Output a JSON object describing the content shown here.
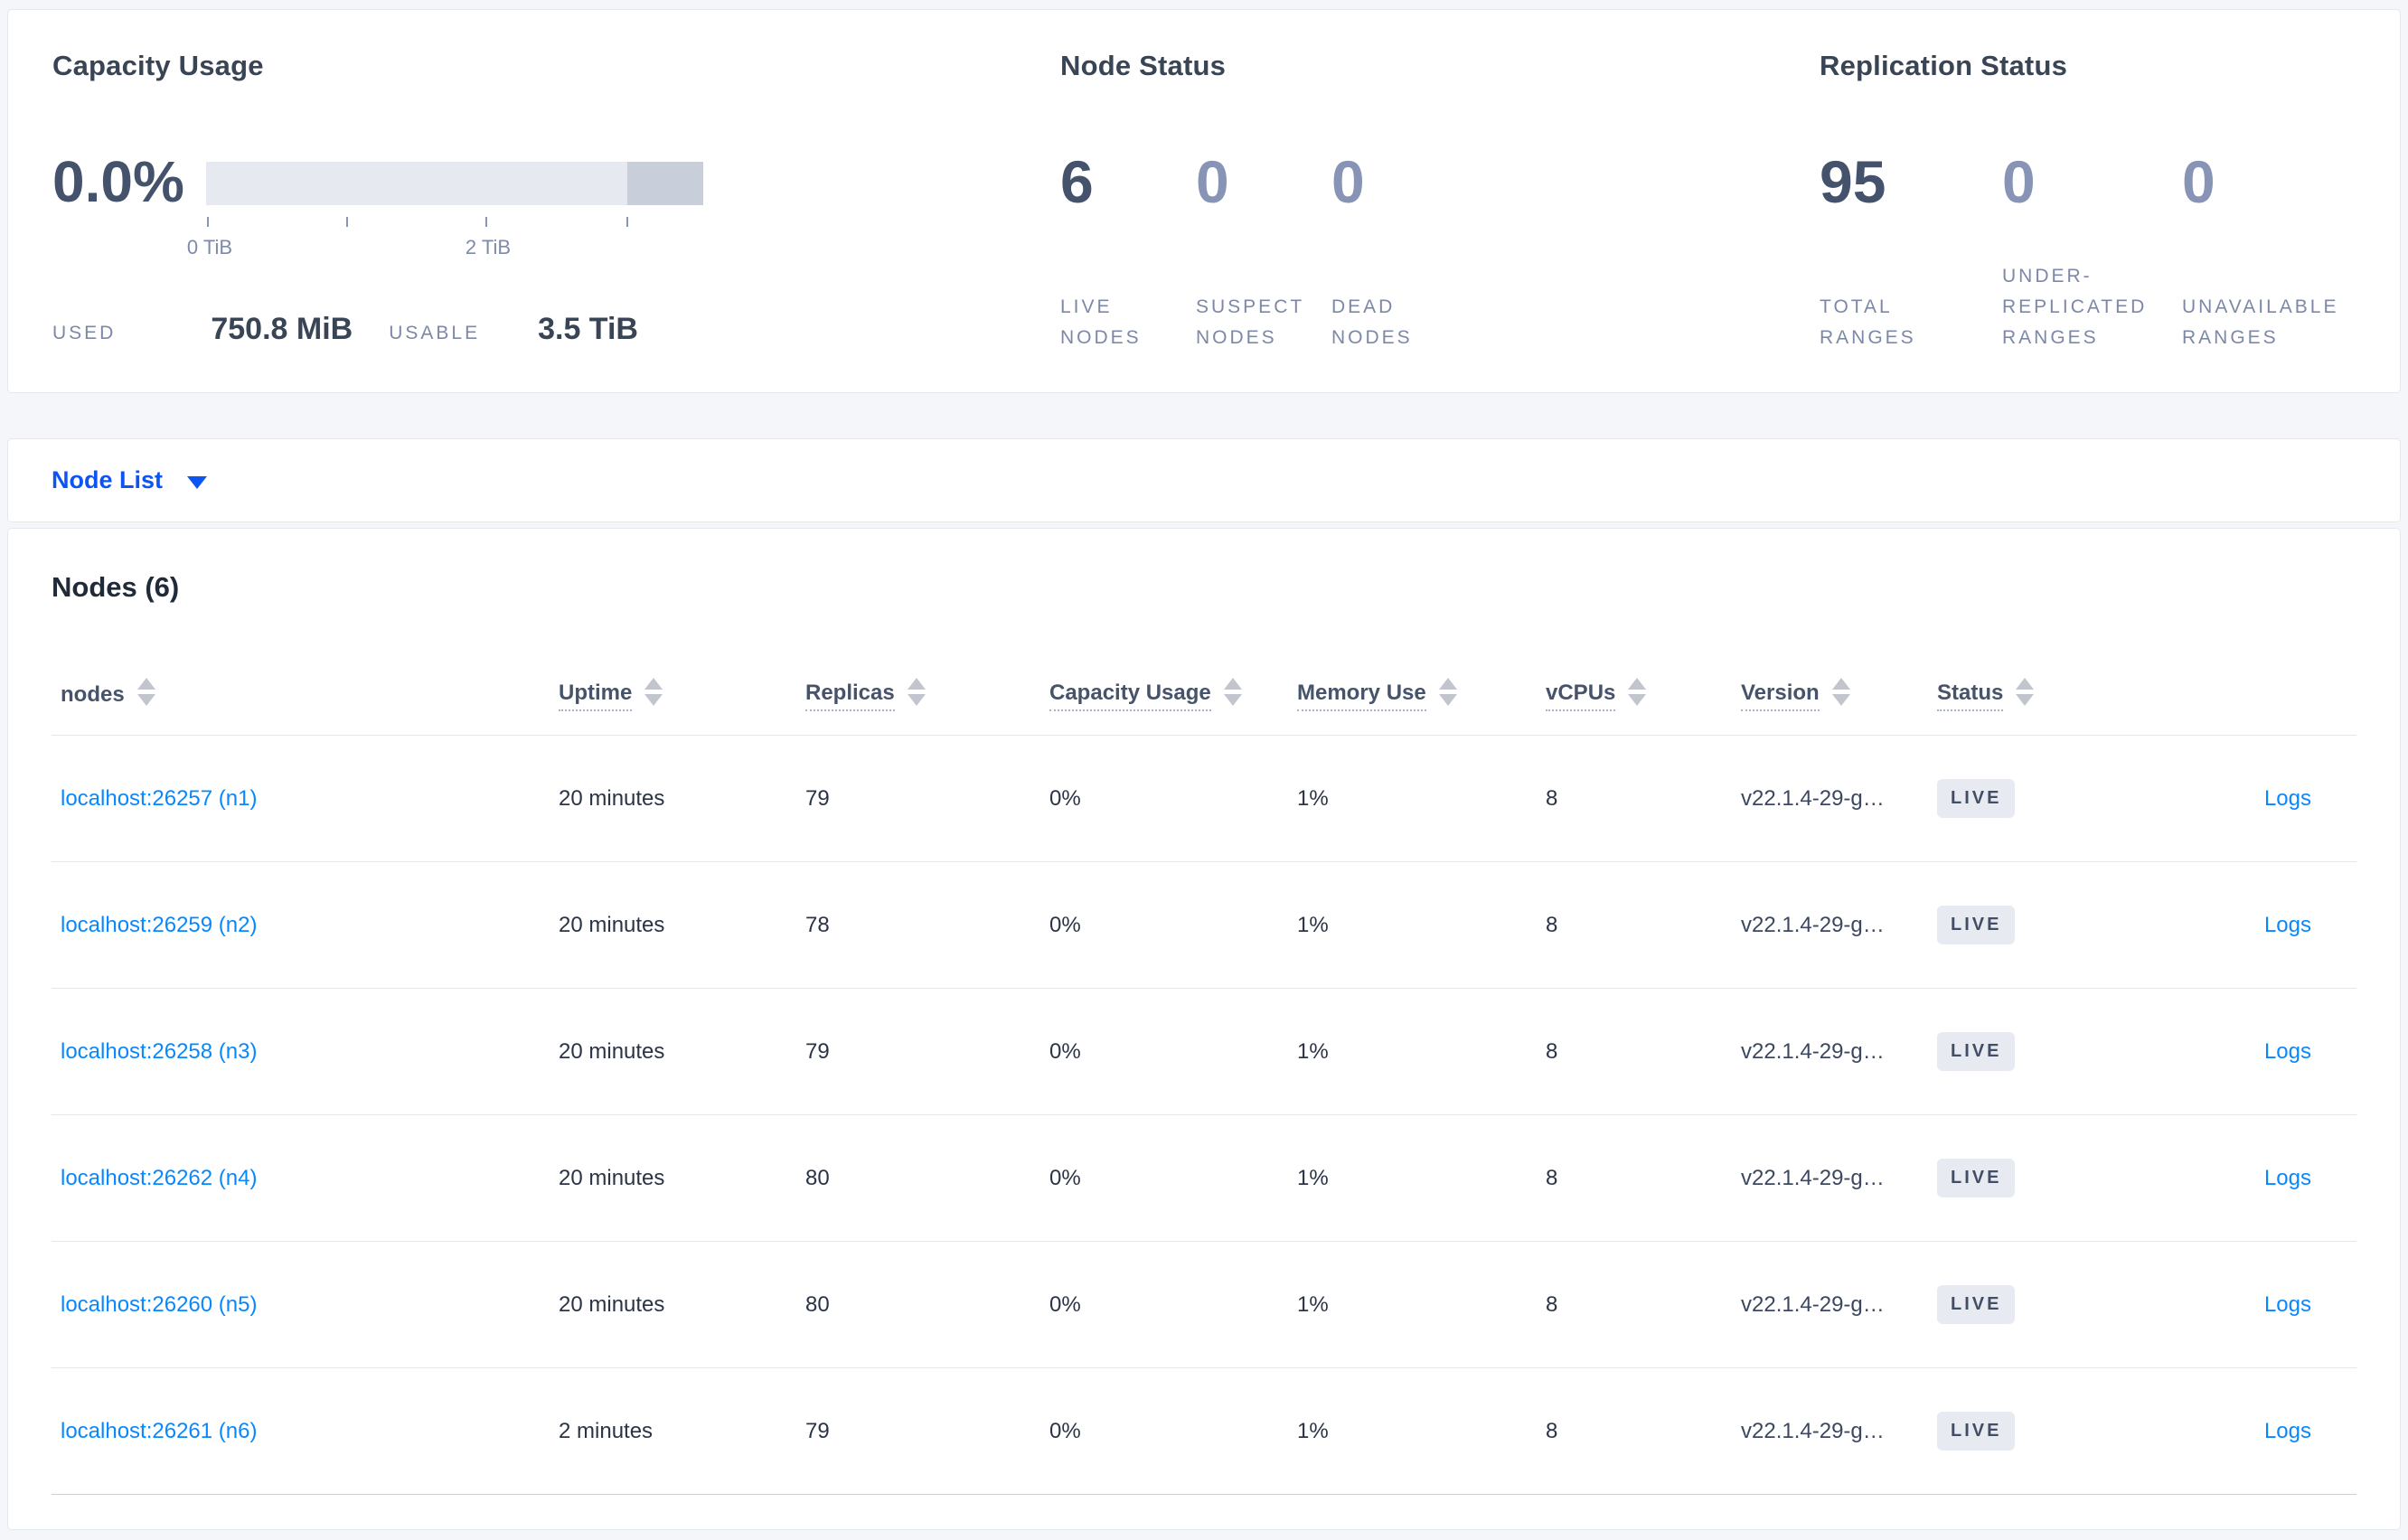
{
  "summary": {
    "capacity": {
      "title": "Capacity Usage",
      "percent": "0.0%",
      "tick_labels": [
        "0 TiB",
        "2 TiB"
      ],
      "used_label": "USED",
      "used_value": "750.8 MiB",
      "usable_label": "USABLE",
      "usable_value": "3.5 TiB"
    },
    "node_status": {
      "title": "Node Status",
      "stats": [
        {
          "value": "6",
          "label": "LIVE NODES"
        },
        {
          "value": "0",
          "label": "SUSPECT NODES"
        },
        {
          "value": "0",
          "label": "DEAD NODES"
        }
      ]
    },
    "replication_status": {
      "title": "Replication Status",
      "stats": [
        {
          "value": "95",
          "label": "TOTAL RANGES"
        },
        {
          "value": "0",
          "label": "UNDER-REPLICATED RANGES"
        },
        {
          "value": "0",
          "label": "UNAVAILABLE RANGES"
        }
      ]
    }
  },
  "node_list_bar": {
    "label": "Node List"
  },
  "nodes_table": {
    "title": "Nodes (6)",
    "columns": [
      "nodes",
      "Uptime",
      "Replicas",
      "Capacity Usage",
      "Memory Use",
      "vCPUs",
      "Version",
      "Status"
    ],
    "logs_label": "Logs",
    "rows": [
      {
        "node": "localhost:26257 (n1)",
        "uptime": "20 minutes",
        "replicas": "79",
        "capacity_usage": "0%",
        "memory_use": "1%",
        "vcpus": "8",
        "version": "v22.1.4-29-g…",
        "status": "LIVE",
        "logs": "Logs"
      },
      {
        "node": "localhost:26259 (n2)",
        "uptime": "20 minutes",
        "replicas": "78",
        "capacity_usage": "0%",
        "memory_use": "1%",
        "vcpus": "8",
        "version": "v22.1.4-29-g…",
        "status": "LIVE",
        "logs": "Logs"
      },
      {
        "node": "localhost:26258 (n3)",
        "uptime": "20 minutes",
        "replicas": "79",
        "capacity_usage": "0%",
        "memory_use": "1%",
        "vcpus": "8",
        "version": "v22.1.4-29-g…",
        "status": "LIVE",
        "logs": "Logs"
      },
      {
        "node": "localhost:26262 (n4)",
        "uptime": "20 minutes",
        "replicas": "80",
        "capacity_usage": "0%",
        "memory_use": "1%",
        "vcpus": "8",
        "version": "v22.1.4-29-g…",
        "status": "LIVE",
        "logs": "Logs"
      },
      {
        "node": "localhost:26260 (n5)",
        "uptime": "20 minutes",
        "replicas": "80",
        "capacity_usage": "0%",
        "memory_use": "1%",
        "vcpus": "8",
        "version": "v22.1.4-29-g…",
        "status": "LIVE",
        "logs": "Logs"
      },
      {
        "node": "localhost:26261 (n6)",
        "uptime": "2 minutes",
        "replicas": "79",
        "capacity_usage": "0%",
        "memory_use": "1%",
        "vcpus": "8",
        "version": "v22.1.4-29-g…",
        "status": "LIVE",
        "logs": "Logs"
      }
    ]
  }
}
